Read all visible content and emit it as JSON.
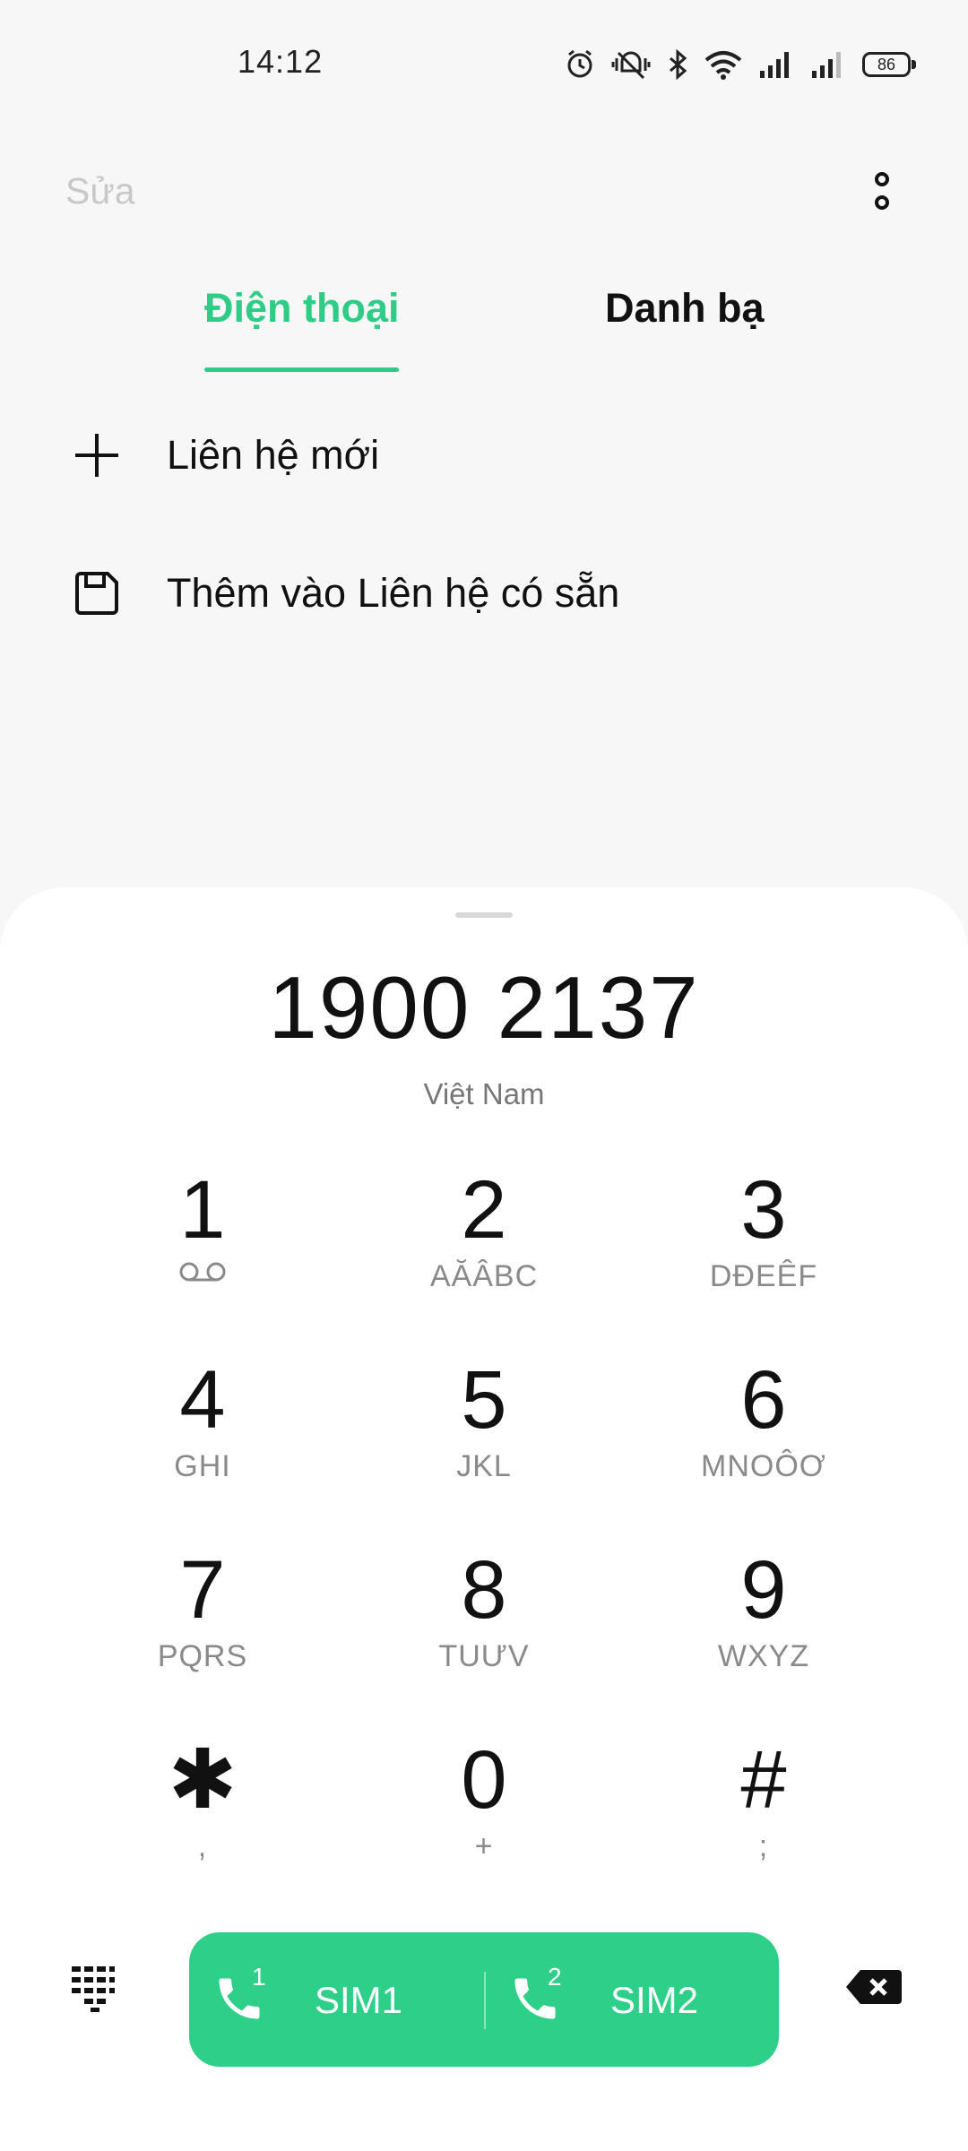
{
  "status_bar": {
    "time": "14:12",
    "battery": "86"
  },
  "header": {
    "edit_label": "Sửa"
  },
  "tabs": [
    {
      "label": "Điện thoại",
      "active": true
    },
    {
      "label": "Danh bạ",
      "active": false
    }
  ],
  "actions": [
    {
      "icon": "plus-icon",
      "label": "Liên hệ mới"
    },
    {
      "icon": "save-icon",
      "label": "Thêm vào Liên hệ có sẵn"
    }
  ],
  "dialer": {
    "number": "1900 2137",
    "country": "Việt Nam",
    "keys": [
      {
        "digit": "1",
        "sub": ""
      },
      {
        "digit": "2",
        "sub": "AĂÂBC"
      },
      {
        "digit": "3",
        "sub": "DĐEÊF"
      },
      {
        "digit": "4",
        "sub": "GHI"
      },
      {
        "digit": "5",
        "sub": "JKL"
      },
      {
        "digit": "6",
        "sub": "MNOÔƠ"
      },
      {
        "digit": "7",
        "sub": "PQRS"
      },
      {
        "digit": "8",
        "sub": "TUƯV"
      },
      {
        "digit": "9",
        "sub": "WXYZ"
      },
      {
        "digit": "✱",
        "sub": ","
      },
      {
        "digit": "0",
        "sub": "+"
      },
      {
        "digit": "#",
        "sub": ";"
      }
    ],
    "sim1": {
      "label": "SIM1",
      "index": "1"
    },
    "sim2": {
      "label": "SIM2",
      "index": "2"
    }
  },
  "colors": {
    "accent": "#2ecc86",
    "call_bar": "#2ecf89"
  }
}
